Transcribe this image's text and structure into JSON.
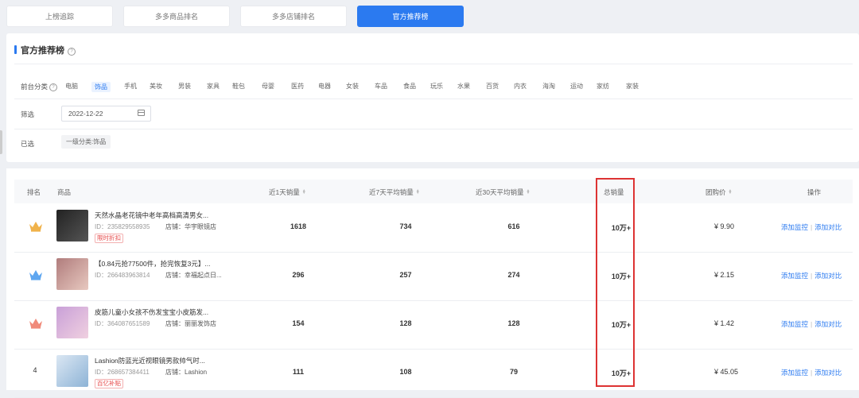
{
  "tabs": [
    {
      "label": "上榜追踪",
      "active": false
    },
    {
      "label": "多多商品排名",
      "active": false
    },
    {
      "label": "多多店铺排名",
      "active": false
    },
    {
      "label": "官方推荐榜",
      "active": true
    }
  ],
  "panel": {
    "title": "官方推荐榜",
    "category_label": "前台分类",
    "categories": [
      "电脑",
      "饰品",
      "手机",
      "美妆",
      "男装",
      "家具",
      "鞋包",
      "母婴",
      "医药",
      "电器",
      "女装",
      "车品",
      "食品",
      "玩乐",
      "水果",
      "百货",
      "内衣",
      "海淘",
      "运动",
      "家纺",
      "家装"
    ],
    "active_category": "饰品",
    "filter_label": "筛选",
    "date_value": "2022-12-22",
    "selected_label": "已选",
    "selected_chip": "一级分类:饰品"
  },
  "table": {
    "headers": {
      "rank": "排名",
      "product": "商品",
      "day1": "近1天销量",
      "day7": "近7天平均销量",
      "day30": "近30天平均销量",
      "total": "总销量",
      "price": "团购价",
      "ops": "操作"
    },
    "id_prefix": "ID：",
    "shop_prefix": "店铺：",
    "op_monitor": "添加监控",
    "op_sep": "|",
    "op_compare": "添加对比",
    "rows": [
      {
        "rank_icon": "crown-gold-icon",
        "rank_text": "",
        "name": "天然水晶老花镜中老年高档高清男女...",
        "id": "235829558935",
        "shop": "华宇眼镜店",
        "tag": "限时折扣",
        "day1": "1618",
        "day7": "734",
        "day30": "616",
        "total": "10万+",
        "price": "¥ 9.90"
      },
      {
        "rank_icon": "crown-blue-icon",
        "rank_text": "",
        "name": "【0.84元抢77500件，抢完恢复3元】...",
        "id": "266483963814",
        "shop": "幸福起点日...",
        "tag": "",
        "day1": "296",
        "day7": "257",
        "day30": "274",
        "total": "10万+",
        "price": "¥ 2.15"
      },
      {
        "rank_icon": "crown-pink-icon",
        "rank_text": "",
        "name": "皮筋儿童小女孩不伤发宝宝小皮筋发...",
        "id": "364087651589",
        "shop": "丽丽发饰店",
        "tag": "",
        "day1": "154",
        "day7": "128",
        "day30": "128",
        "total": "10万+",
        "price": "¥ 1.42"
      },
      {
        "rank_icon": "",
        "rank_text": "4",
        "name": "Lashion防蓝光近视眼镜男款帅气时...",
        "id": "268657384411",
        "shop": "Lashion",
        "tag": "百亿补贴",
        "day1": "111",
        "day7": "108",
        "day30": "79",
        "total": "10万+",
        "price": "¥ 45.05"
      }
    ]
  },
  "colors": {
    "accent": "#2b7af0",
    "highlight": "#dd3333",
    "gold": "#f0b24a",
    "blue": "#5ea6f0",
    "pink": "#f08a7a"
  }
}
